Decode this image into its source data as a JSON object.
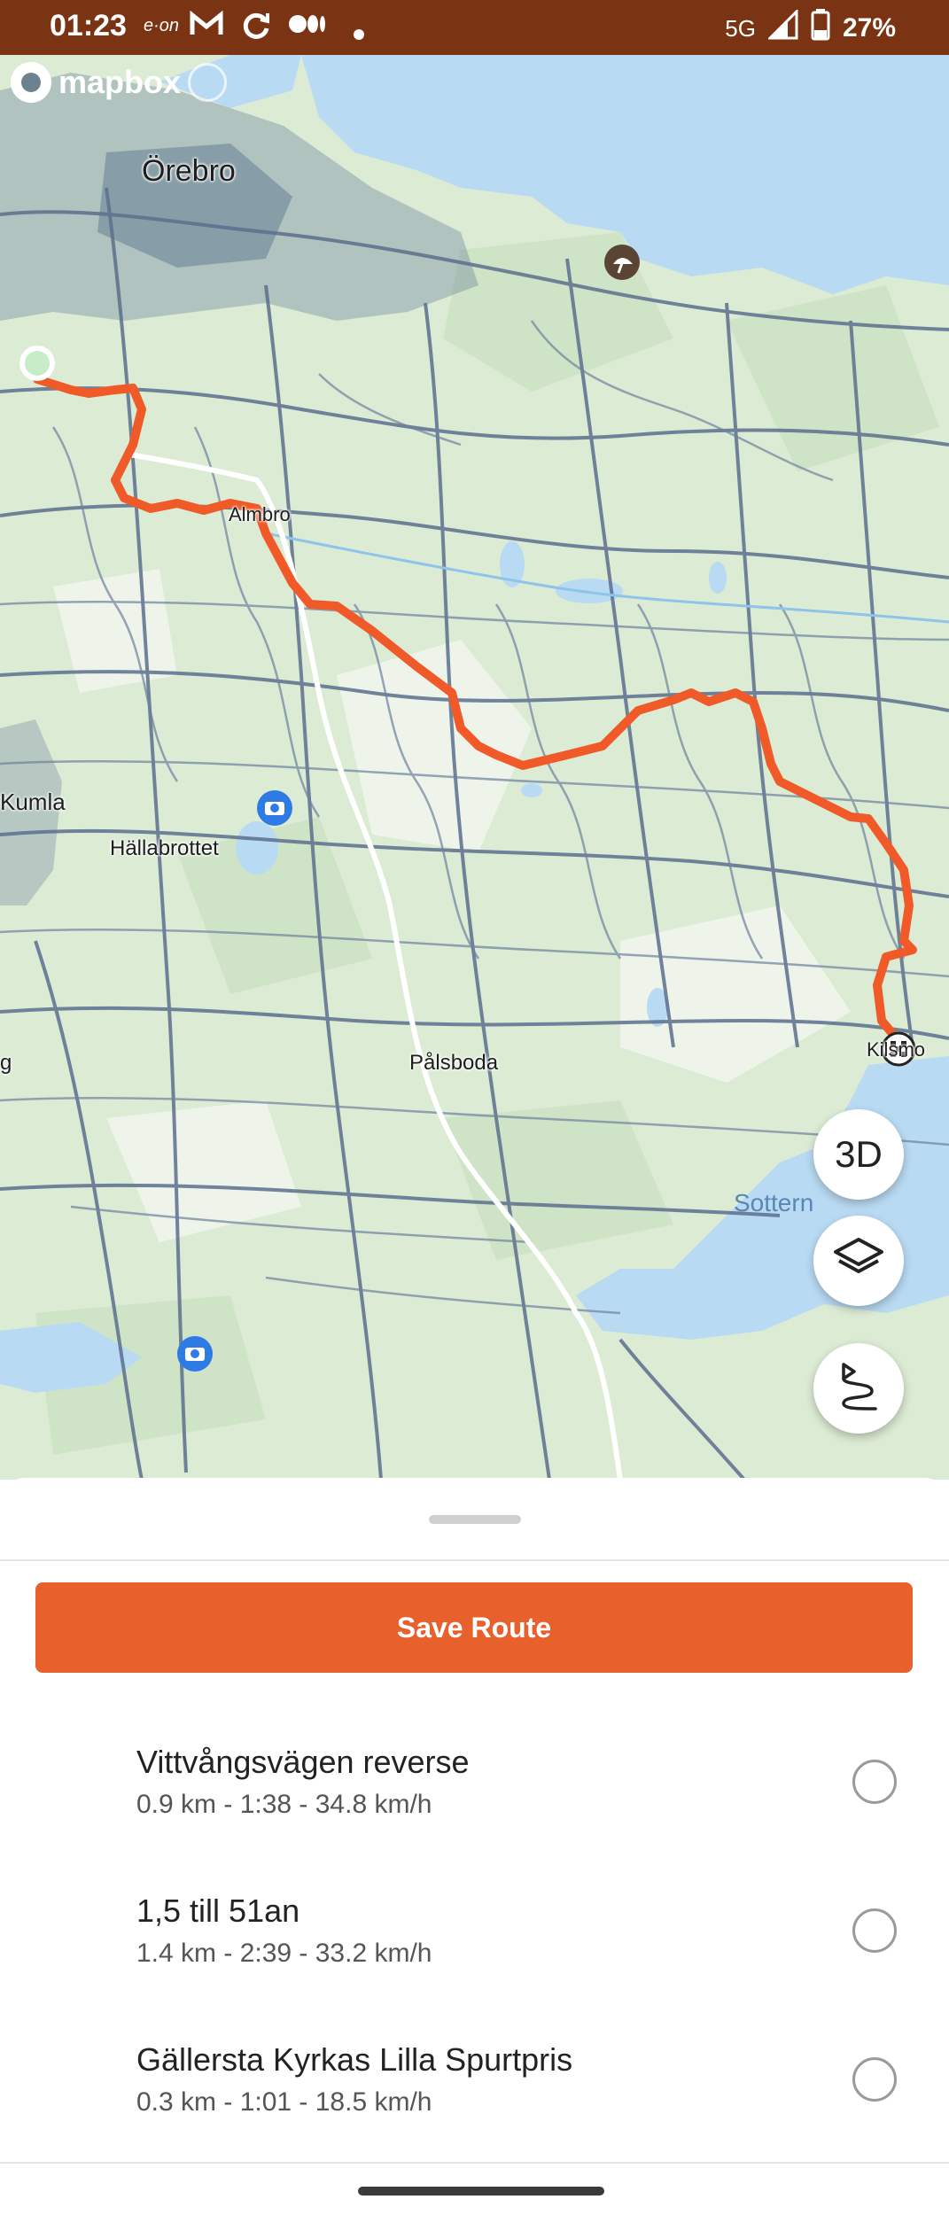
{
  "status_bar": {
    "time": "01:23",
    "icons": [
      "eon-icon",
      "gmail-icon",
      "sync-icon",
      "medium-icon",
      "dot-icon"
    ],
    "network": "5G",
    "battery": "27%"
  },
  "map": {
    "attribution": "mapbox",
    "labels": {
      "orebro": "Örebro",
      "almbro": "Almbro",
      "kumla": "Kumla",
      "hallabrottet": "Hällabrottet",
      "palsboda": "Pålsboda",
      "kilsmo": "Kilsmo",
      "sottern": "Sottern",
      "partial_g": "g"
    },
    "route_color": "#f05a28",
    "water_color": "#b9daf3",
    "land_color": "#dcebd4"
  },
  "controls": {
    "three_d_label": "3D",
    "layers_icon": "layers-icon",
    "route_icon": "route-icon"
  },
  "sheet": {
    "save_button_label": "Save Route",
    "segments": [
      {
        "name": "Vittvångsvägen reverse",
        "stats": "0.9 km - 1:38 - 34.8 km/h"
      },
      {
        "name": "1,5 till 51an",
        "stats": "1.4 km - 2:39 - 33.2 km/h"
      },
      {
        "name": "Gällersta Kyrkas Lilla Spurtpris",
        "stats": "0.3 km - 1:01 - 18.5 km/h"
      }
    ]
  }
}
